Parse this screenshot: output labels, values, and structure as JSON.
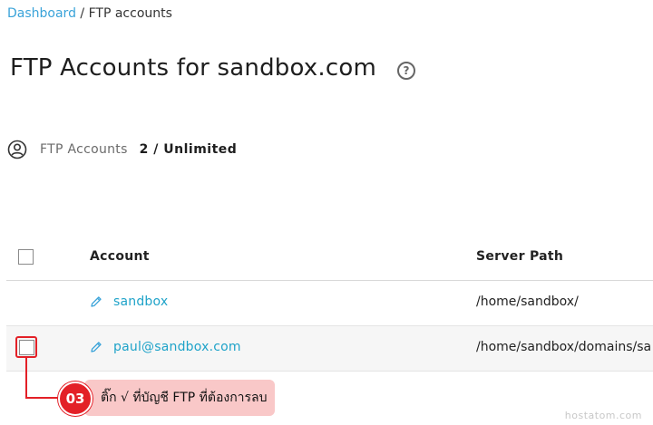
{
  "breadcrumb": {
    "root": "Dashboard",
    "separator": " / ",
    "current": "FTP accounts"
  },
  "page": {
    "title": "FTP Accounts for sandbox.com",
    "help_icon": "question-circle-icon"
  },
  "stats": {
    "icon": "user-circle-icon",
    "label": "FTP Accounts",
    "value": "2 / Unlimited"
  },
  "table": {
    "headers": {
      "account": "Account",
      "server_path": "Server Path"
    },
    "rows": [
      {
        "account": "sandbox",
        "path": "/home/sandbox/",
        "edit_icon": "pencil-icon",
        "has_checkbox": false
      },
      {
        "account": "paul@sandbox.com",
        "path": "/home/sandbox/domains/sa",
        "edit_icon": "pencil-icon",
        "has_checkbox": true
      }
    ]
  },
  "annotation": {
    "step": "03",
    "text": "ติ๊ก √ ที่บัญชี FTP ที่ต้องการลบ"
  },
  "watermark": "hostatom.com",
  "colors": {
    "link": "#1fa3c9",
    "breadcrumb_link": "#3aa3d9",
    "accent_red": "#e32027",
    "callout_bg": "#f9c8c8"
  }
}
